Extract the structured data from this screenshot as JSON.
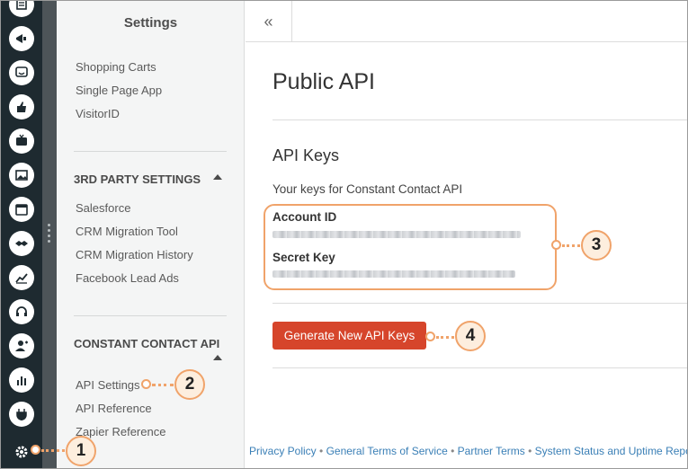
{
  "rail": {
    "icons": [
      "list-icon",
      "megaphone-icon",
      "chat-smile-icon",
      "thumbs-up-icon",
      "tv-icon",
      "image-icon",
      "calendar-icon",
      "handshake-icon",
      "trend-chart-icon",
      "headset-icon",
      "user-add-icon",
      "bar-chart-icon",
      "plug-icon",
      "gear-icon"
    ],
    "colors": {
      "background": "#1e2a30",
      "icon_fill": "#ffffff",
      "icon_stroke": "#1e2a30"
    }
  },
  "nav": {
    "title": "Settings",
    "group1": [
      "Shopping Carts",
      "Single Page App",
      "VisitorID"
    ],
    "third_party": {
      "heading": "3RD PARTY SETTINGS",
      "items": [
        "Salesforce",
        "CRM Migration Tool",
        "CRM Migration History",
        "Facebook Lead Ads"
      ]
    },
    "constant_contact": {
      "heading": "CONSTANT CONTACT API",
      "items": [
        "API Settings",
        "API Reference",
        "Zapier Reference"
      ]
    }
  },
  "main": {
    "collapse_label": "«",
    "title": "Public API",
    "section_title": "API Keys",
    "description": "Your keys for Constant Contact API",
    "account_id_label": "Account ID",
    "secret_key_label": "Secret Key",
    "generate_button": "Generate New API Keys"
  },
  "footer": {
    "links": [
      "Privacy Policy",
      "General Terms of Service",
      "Partner Terms",
      "System Status and Uptime Report"
    ],
    "separator": "•"
  },
  "callouts": [
    "1",
    "2",
    "3",
    "4"
  ],
  "colors": {
    "accent_button": "#d6452b",
    "callout_border": "#f0a36a",
    "callout_fill": "#fdeede",
    "link": "#3a7fb6"
  }
}
